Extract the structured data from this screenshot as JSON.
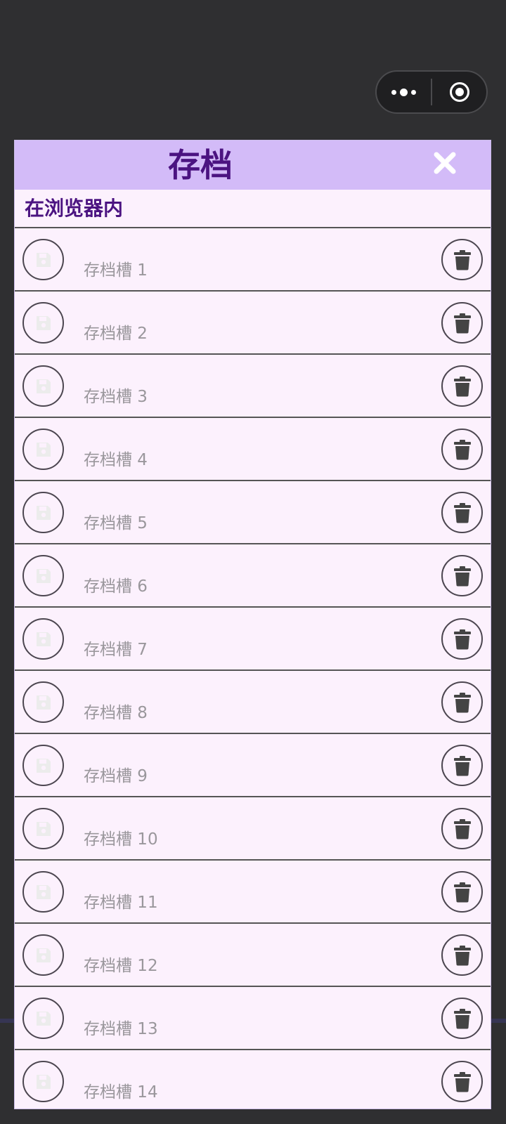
{
  "topbar": {
    "more_icon": "more-dots-icon",
    "close_icon": "target-circle-icon"
  },
  "dialog": {
    "title": "存档",
    "close_icon": "close-x-icon",
    "section_label": "在浏览器内",
    "slots": [
      {
        "label": "存档槽 1"
      },
      {
        "label": "存档槽 2"
      },
      {
        "label": "存档槽 3"
      },
      {
        "label": "存档槽 4"
      },
      {
        "label": "存档槽 5"
      },
      {
        "label": "存档槽 6"
      },
      {
        "label": "存档槽 7"
      },
      {
        "label": "存档槽 8"
      },
      {
        "label": "存档槽 9"
      },
      {
        "label": "存档槽 10"
      },
      {
        "label": "存档槽 11"
      },
      {
        "label": "存档槽 12"
      },
      {
        "label": "存档槽 13"
      },
      {
        "label": "存档槽 14"
      }
    ],
    "slot_save_icon": "floppy-disk-icon",
    "slot_delete_icon": "trash-icon"
  },
  "colors": {
    "header_bg": "#d3bbf8",
    "title_text": "#4b1381",
    "dialog_bg": "#fcf1fd",
    "slot_text": "#9a979c",
    "page_bg": "#2f2f31"
  }
}
